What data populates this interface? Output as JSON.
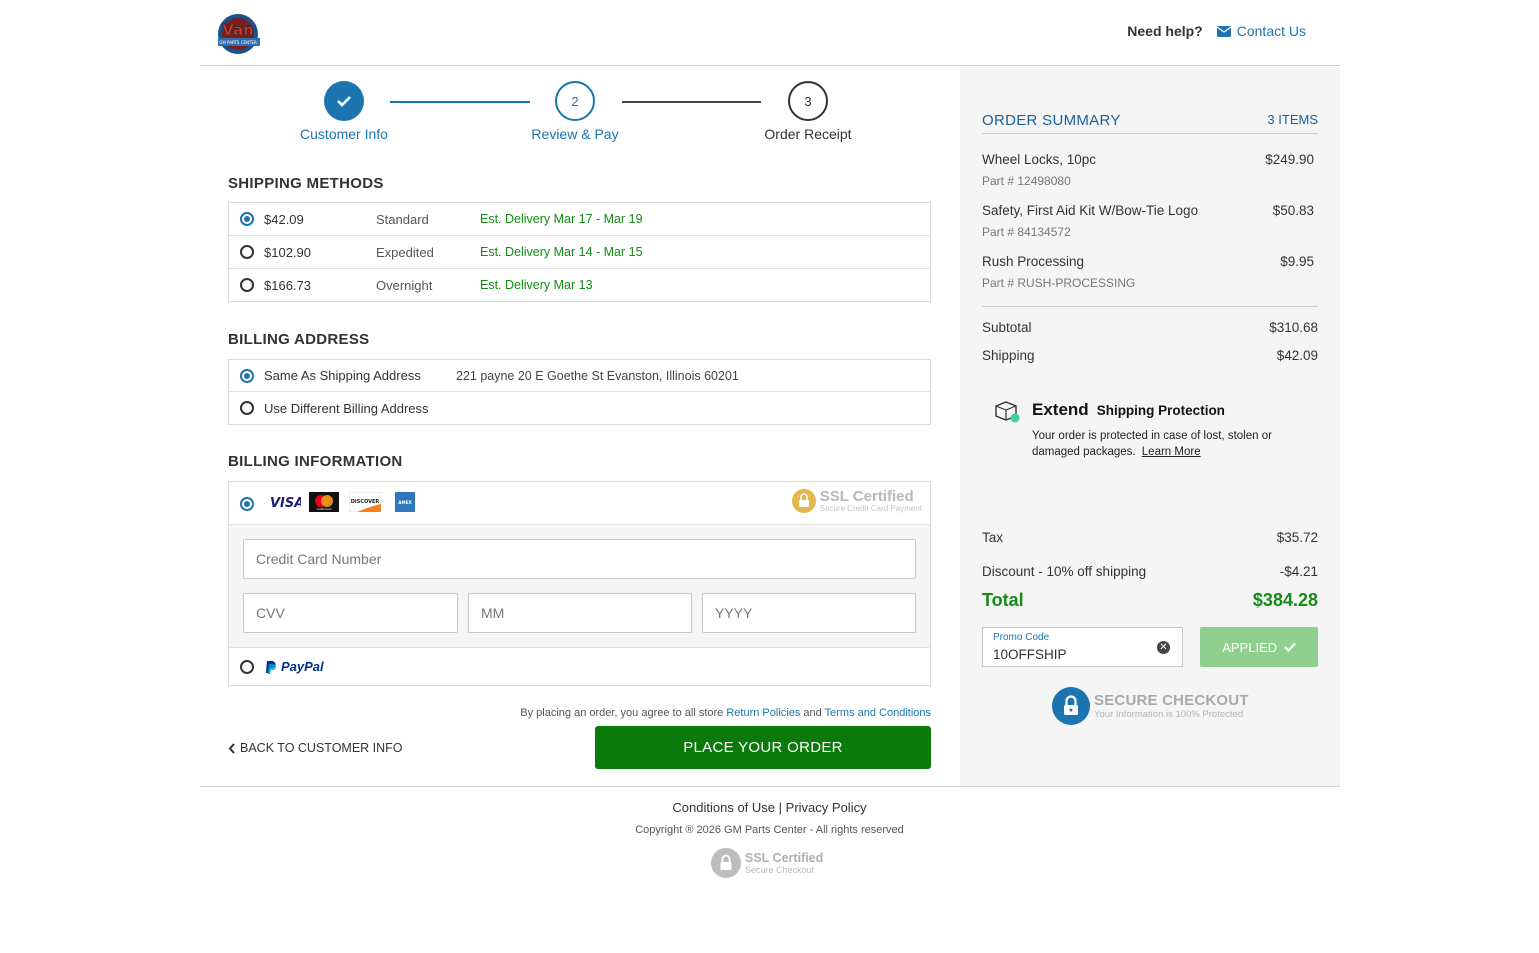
{
  "header": {
    "logo_text": "Van",
    "logo_sub": "GM PARTS CENTER",
    "need_help": "Need help?",
    "contact_label": "Contact Us"
  },
  "steps": [
    {
      "number": "",
      "label": "Customer Info",
      "state": "done"
    },
    {
      "number": "2",
      "label": "Review & Pay",
      "state": "current"
    },
    {
      "number": "3",
      "label": "Order Receipt",
      "state": "upcoming"
    }
  ],
  "shipping": {
    "title": "SHIPPING METHODS",
    "options": [
      {
        "price": "$42.09",
        "name": "Standard",
        "eta": "Est. Delivery Mar 17 - Mar 19",
        "selected": true
      },
      {
        "price": "$102.90",
        "name": "Expedited",
        "eta": "Est. Delivery Mar 14 - Mar 15",
        "selected": false
      },
      {
        "price": "$166.73",
        "name": "Overnight",
        "eta": "Est. Delivery Mar 13",
        "selected": false
      }
    ]
  },
  "billing_address": {
    "title": "BILLING ADDRESS",
    "same_label": "Same As Shipping Address",
    "same_address": "221 payne 20 E Goethe St Evanston, Illinois 60201",
    "different_label": "Use Different Billing Address"
  },
  "billing_info": {
    "title": "BILLING INFORMATION",
    "cards": [
      "VISA",
      "mastercard",
      "DISCOVER",
      "AMEX"
    ],
    "ssl_title": "SSL Certified",
    "ssl_sub": "Secure Credit Card Payment",
    "card_number_placeholder": "Credit Card Number",
    "cvv_placeholder": "CVV",
    "mm_placeholder": "MM",
    "yyyy_placeholder": "YYYY",
    "paypal_label": "PayPal"
  },
  "agree": {
    "prefix": "By placing an order, you agree to all store",
    "return_link": "Return Policies",
    "and": "and",
    "terms_link": "Terms and Conditions"
  },
  "actions": {
    "back_label": "BACK TO CUSTOMER INFO",
    "place_label": "PLACE YOUR ORDER"
  },
  "summary": {
    "title": "ORDER SUMMARY",
    "count": "3 ITEMS",
    "items": [
      {
        "name": "Wheel Locks, 10pc",
        "part": "Part # 12498080",
        "price": "$249.90"
      },
      {
        "name": "Safety, First Aid Kit W/Bow-Tie Logo",
        "part": "Part # 84134572",
        "price": "$50.83"
      },
      {
        "name": "Rush Processing",
        "part": "Part # RUSH-PROCESSING",
        "price": "$9.95"
      }
    ],
    "subtotal_label": "Subtotal",
    "subtotal": "$310.68",
    "shipping_label": "Shipping",
    "shipping": "$42.09",
    "extend_brand": "Extend",
    "extend_title": "Shipping Protection",
    "extend_text_1": "Your order is protected in case of lost, stolen or",
    "extend_text_2": "damaged packages.",
    "extend_link": "Learn More",
    "tax_label": "Tax",
    "tax": "$35.72",
    "discount_label": "Discount - 10% off shipping",
    "discount": "-$4.21",
    "total_label": "Total",
    "total": "$384.28",
    "promo_label": "Promo Code",
    "promo_value": "10OFFSHIP",
    "applied_label": "APPLIED",
    "secure_title": "SECURE CHECKOUT",
    "secure_sub": "Your Information is 100% Protected"
  },
  "footer": {
    "conditions": "Conditions of Use",
    "sep": "|",
    "privacy": "Privacy Policy",
    "copyright": "Copyright ® 2026 GM Parts Center - All rights reserved",
    "ssl_title": "SSL Certified",
    "ssl_sub": "Secure Checkout"
  },
  "colors": {
    "brand_blue": "#1c75b0",
    "success_green": "#0a7a0a",
    "applied_green": "#8fd08f"
  }
}
